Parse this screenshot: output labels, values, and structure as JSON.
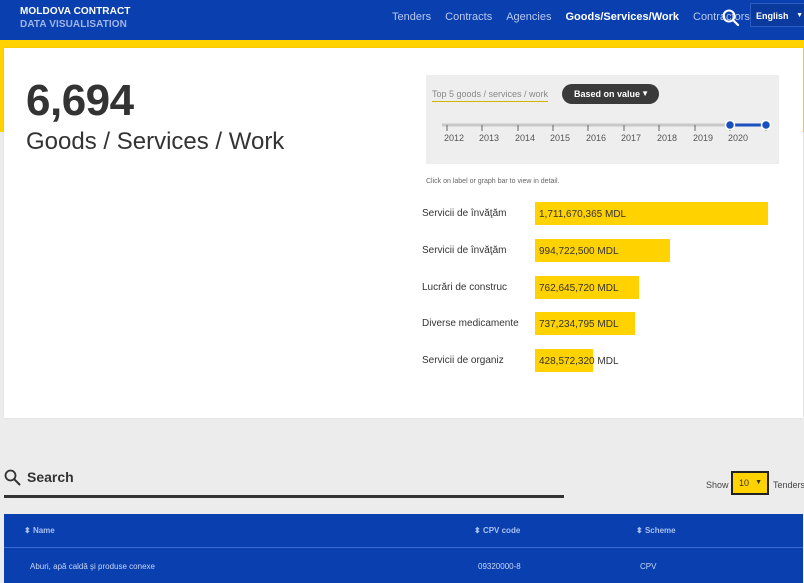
{
  "header": {
    "brand_line1": "MOLDOVA CONTRACT",
    "brand_line2": "DATA VISUALISATION",
    "nav": [
      "Tenders",
      "Contracts",
      "Agencies",
      "Goods/Services/Work",
      "Contractors"
    ],
    "active_nav": "Goods/Services/Work",
    "language": "English"
  },
  "summary": {
    "count": "6,694",
    "label": "Goods / Services / Work"
  },
  "filter": {
    "label": "Top 5 goods / services / work",
    "sort_dropdown": "Based on value",
    "years": [
      "2012",
      "2013",
      "2014",
      "2015",
      "2016",
      "2017",
      "2018",
      "2019",
      "2020"
    ],
    "range_start_position": "between 2019 and 2020",
    "range_end_position": "end"
  },
  "hint": "Click on label or graph bar to view in detail.",
  "chart_data": {
    "type": "bar",
    "orientation": "horizontal",
    "categories": [
      "Servicii de învăţăm",
      "Servicii de învăţăm",
      "Lucrări de construc",
      "Diverse medicamente",
      "Servicii de organiz"
    ],
    "values": [
      1711670365,
      994722500,
      762645720,
      737234795,
      428572320
    ],
    "value_labels": [
      "1,711,670,365 MDL",
      "994,722,500 MDL",
      "762,645,720 MDL",
      "737,234,795 MDL",
      "428,572,320 MDL"
    ],
    "unit": "MDL",
    "color": "#ffd200"
  },
  "search": {
    "title": "Search",
    "show_label": "Show",
    "page_size": "10",
    "suffix": "Tenders"
  },
  "table": {
    "columns": [
      "Name",
      "CPV code",
      "Scheme"
    ],
    "rows": [
      [
        "Aburi, apă caldă şi produse conexe",
        "09320000-8",
        "CPV"
      ]
    ]
  },
  "colors": {
    "primary": "#0a3fb0",
    "accent": "#ffd200"
  }
}
